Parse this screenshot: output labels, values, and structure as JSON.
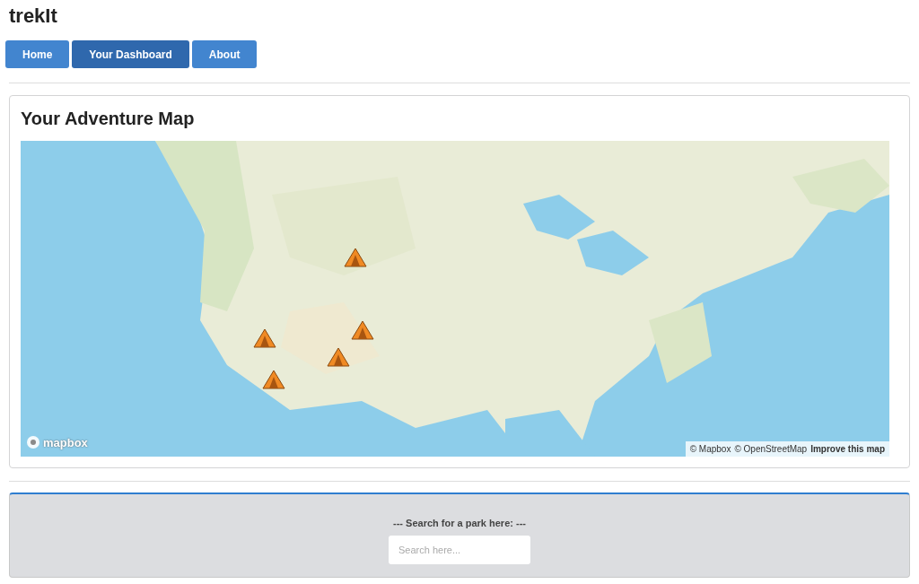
{
  "app_title": "trekIt",
  "nav": [
    {
      "label": "Home",
      "selected": false
    },
    {
      "label": "Your Dashboard",
      "selected": true
    },
    {
      "label": "About",
      "selected": false
    }
  ],
  "map_card": {
    "title": "Your Adventure Map",
    "logo_text": "mapbox",
    "attribution": [
      "© Mapbox",
      "© OpenStreetMap",
      "Improve this map"
    ]
  },
  "search": {
    "label": "--- Search for a park here: ---",
    "placeholder": "Search here..."
  }
}
